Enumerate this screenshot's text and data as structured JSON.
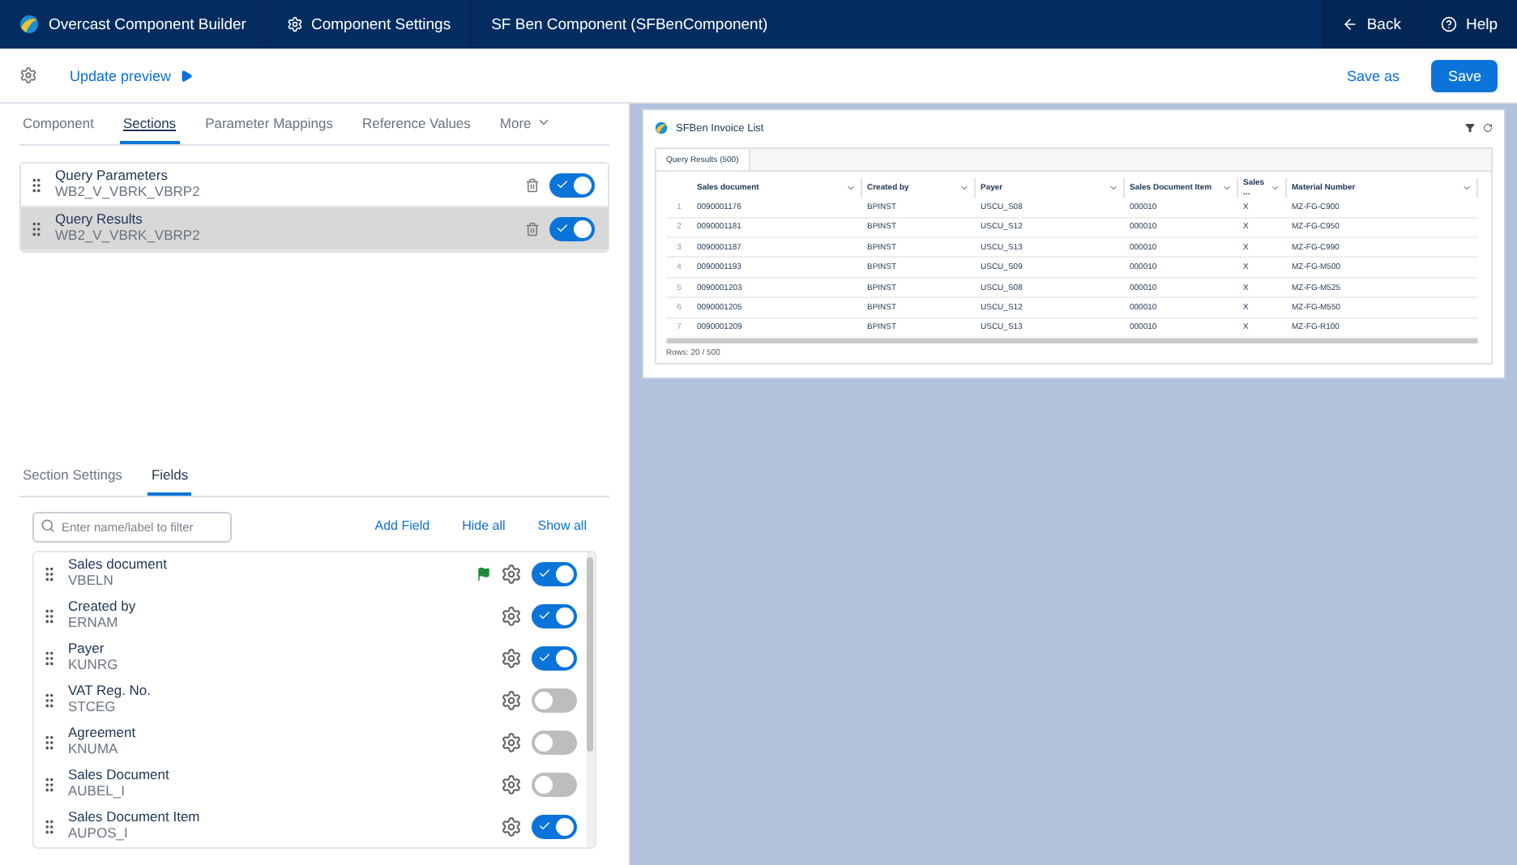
{
  "top_bar": {
    "app_title": "Overcast Component Builder",
    "settings_link": "Component Settings",
    "component_name": "SF Ben Component (SFBenComponent)",
    "back": "Back",
    "help": "Help"
  },
  "toolbar": {
    "update_preview": "Update preview",
    "save_as": "Save as",
    "save": "Save"
  },
  "tabs": [
    {
      "label": "Component",
      "selected": false
    },
    {
      "label": "Sections",
      "selected": true
    },
    {
      "label": "Parameter Mappings",
      "selected": false
    },
    {
      "label": "Reference Values",
      "selected": false
    }
  ],
  "more_tab": "More",
  "sections": [
    {
      "name": "Query Parameters",
      "table": "WB2_V_VBRK_VBRP2",
      "selected": false,
      "on": true
    },
    {
      "name": "Query Results",
      "table": "WB2_V_VBRK_VBRP2",
      "selected": true,
      "on": true
    }
  ],
  "sub_tabs": [
    {
      "label": "Section Settings",
      "selected": false
    },
    {
      "label": "Fields",
      "selected": true
    }
  ],
  "filter": {
    "placeholder": "Enter name/label to filter"
  },
  "field_actions": [
    "Add Field",
    "Hide all",
    "Show all"
  ],
  "fields": [
    {
      "label": "Sales document",
      "name": "VBELN",
      "flagged": true,
      "on": true
    },
    {
      "label": "Created by",
      "name": "ERNAM",
      "flagged": false,
      "on": true
    },
    {
      "label": "Payer",
      "name": "KUNRG",
      "flagged": false,
      "on": true
    },
    {
      "label": "VAT Reg. No.",
      "name": "STCEG",
      "flagged": false,
      "on": false
    },
    {
      "label": "Agreement",
      "name": "KNUMA",
      "flagged": false,
      "on": false
    },
    {
      "label": "Sales Document",
      "name": "AUBEL_I",
      "flagged": false,
      "on": false
    },
    {
      "label": "Sales Document Item",
      "name": "AUPOS_I",
      "flagged": false,
      "on": true
    }
  ],
  "preview": {
    "title": "SFBen Invoice List",
    "tab": "Query Results (500)",
    "columns": [
      "",
      "Sales document",
      "Created by",
      "Payer",
      "Sales Document Item",
      "Sales ...",
      "Material Number"
    ],
    "rows": [
      [
        "1",
        "0090001176",
        "BPINST",
        "USCU_S08",
        "000010",
        "X",
        "MZ-FG-C900"
      ],
      [
        "2",
        "0090001181",
        "BPINST",
        "USCU_S12",
        "000010",
        "X",
        "MZ-FG-C950"
      ],
      [
        "3",
        "0090001187",
        "BPINST",
        "USCU_S13",
        "000010",
        "X",
        "MZ-FG-C990"
      ],
      [
        "4",
        "0090001193",
        "BPINST",
        "USCU_S09",
        "000010",
        "X",
        "MZ-FG-M500"
      ],
      [
        "5",
        "0090001203",
        "BPINST",
        "USCU_S08",
        "000010",
        "X",
        "MZ-FG-M525"
      ],
      [
        "6",
        "0090001205",
        "BPINST",
        "USCU_S12",
        "000010",
        "X",
        "MZ-FG-M550"
      ],
      [
        "7",
        "0090001209",
        "BPINST",
        "USCU_S13",
        "000010",
        "X",
        "MZ-FG-R100"
      ]
    ],
    "footer": "Rows: 20 / 500"
  }
}
